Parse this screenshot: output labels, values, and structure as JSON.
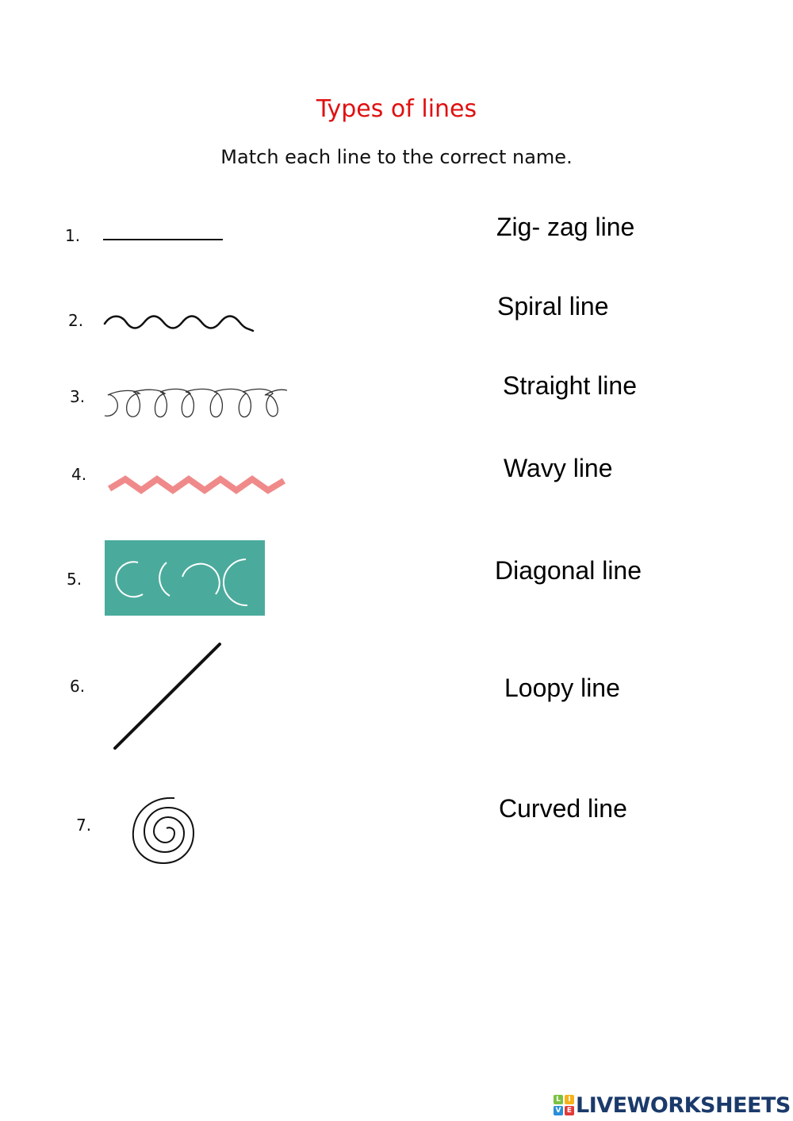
{
  "worksheet": {
    "title": "Types of lines",
    "instruction": "Match each line to the correct name.",
    "items": [
      {
        "number": "1.",
        "drawing": "straight-line"
      },
      {
        "number": "2.",
        "drawing": "wavy-line"
      },
      {
        "number": "3.",
        "drawing": "loopy-line"
      },
      {
        "number": "4.",
        "drawing": "zig-zag-line"
      },
      {
        "number": "5.",
        "drawing": "curved-lines"
      },
      {
        "number": "6.",
        "drawing": "diagonal-line"
      },
      {
        "number": "7.",
        "drawing": "spiral-line"
      }
    ],
    "names": [
      "Zig- zag line",
      "Spiral line",
      "Straight line",
      "Wavy line",
      "Diagonal line",
      "Loopy line",
      "Curved line"
    ],
    "colors": {
      "title": "#e01010",
      "zigzag": "#f08a8a",
      "curved_box": "#4aab9c",
      "logo_text": "#1b3a6b"
    }
  },
  "footer": {
    "logo_letters": [
      "L",
      "I",
      "V",
      "E"
    ],
    "logo_text": "LIVEWORKSHEETS"
  }
}
